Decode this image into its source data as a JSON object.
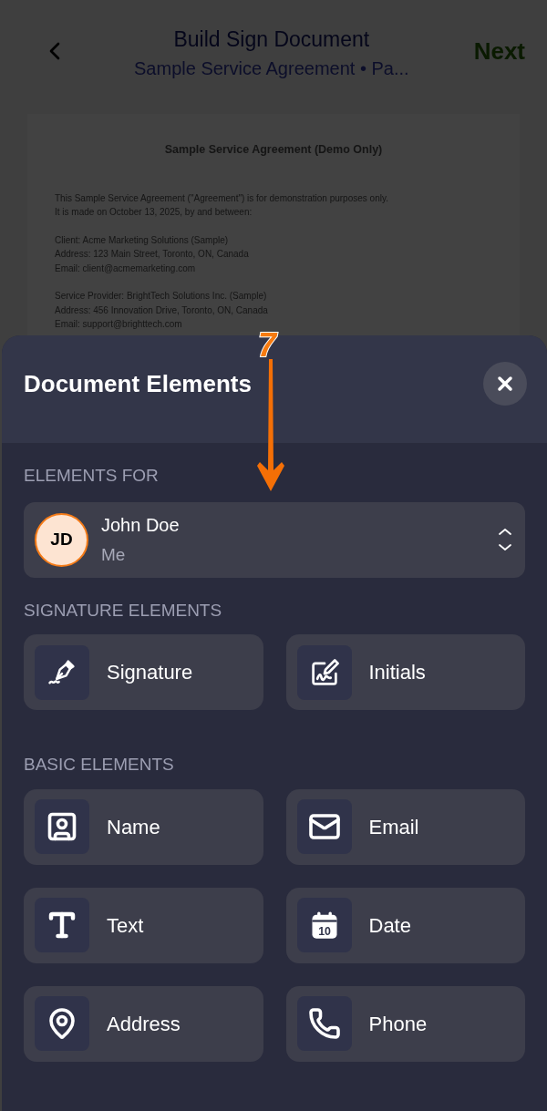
{
  "header": {
    "title": "Build Sign Document",
    "subtitle": "Sample Service Agreement • Pa...",
    "next": "Next"
  },
  "document": {
    "title": "Sample Service Agreement (Demo Only)",
    "paragraphs": [
      [
        "This Sample Service Agreement (\"Agreement\") is for demonstration purposes only.",
        "It is made on October 13, 2025, by and between:"
      ],
      [
        "Client: Acme Marketing Solutions (Sample)",
        "Address: 123 Main Street, Toronto, ON, Canada",
        "Email: client@acmemarketing.com"
      ],
      [
        "Service Provider: BrightTech Solutions Inc. (Sample)",
        "Address: 456 Innovation Drive, Toronto, ON, Canada",
        "Email: support@brighttech.com"
      ]
    ]
  },
  "annotation": {
    "step": "7"
  },
  "sheet": {
    "title": "Document Elements",
    "elements_for": {
      "label": "ELEMENTS FOR",
      "initials": "JD",
      "name": "John Doe",
      "role": "Me"
    },
    "sections": [
      {
        "label": "SIGNATURE ELEMENTS",
        "items": [
          {
            "kind": "signature",
            "label": "Signature"
          },
          {
            "kind": "initials",
            "label": "Initials"
          }
        ]
      },
      {
        "label": "BASIC ELEMENTS",
        "items": [
          {
            "kind": "name",
            "label": "Name"
          },
          {
            "kind": "email",
            "label": "Email"
          },
          {
            "kind": "text",
            "label": "Text"
          },
          {
            "kind": "date",
            "label": "Date",
            "icon_label": "10"
          },
          {
            "kind": "address",
            "label": "Address"
          },
          {
            "kind": "phone",
            "label": "Phone"
          }
        ]
      }
    ]
  }
}
